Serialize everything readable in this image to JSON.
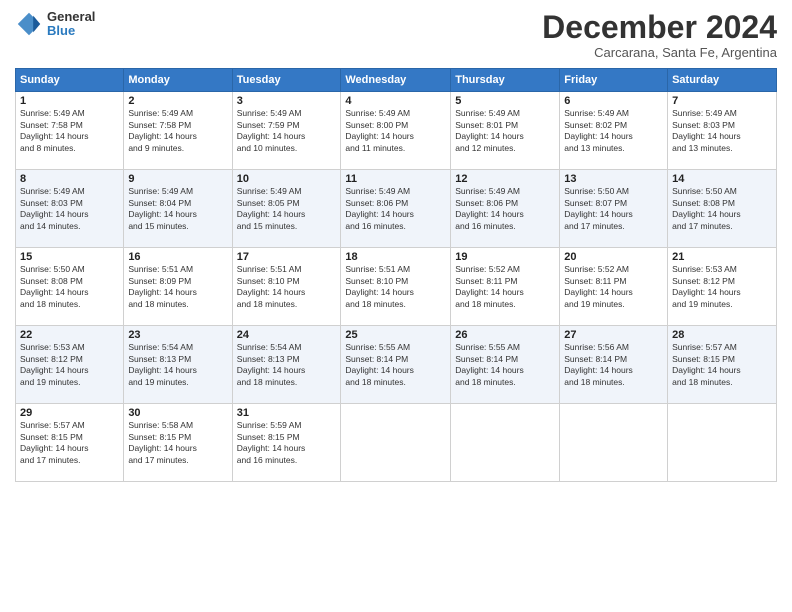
{
  "header": {
    "logo": {
      "general": "General",
      "blue": "Blue"
    },
    "title": "December 2024",
    "subtitle": "Carcarana, Santa Fe, Argentina"
  },
  "calendar": {
    "days_of_week": [
      "Sunday",
      "Monday",
      "Tuesday",
      "Wednesday",
      "Thursday",
      "Friday",
      "Saturday"
    ],
    "weeks": [
      [
        {
          "day": "1",
          "sunrise": "5:49 AM",
          "sunset": "7:58 PM",
          "daylight": "14 hours and 8 minutes."
        },
        {
          "day": "2",
          "sunrise": "5:49 AM",
          "sunset": "7:58 PM",
          "daylight": "14 hours and 9 minutes."
        },
        {
          "day": "3",
          "sunrise": "5:49 AM",
          "sunset": "7:59 PM",
          "daylight": "14 hours and 10 minutes."
        },
        {
          "day": "4",
          "sunrise": "5:49 AM",
          "sunset": "8:00 PM",
          "daylight": "14 hours and 11 minutes."
        },
        {
          "day": "5",
          "sunrise": "5:49 AM",
          "sunset": "8:01 PM",
          "daylight": "14 hours and 12 minutes."
        },
        {
          "day": "6",
          "sunrise": "5:49 AM",
          "sunset": "8:02 PM",
          "daylight": "14 hours and 13 minutes."
        },
        {
          "day": "7",
          "sunrise": "5:49 AM",
          "sunset": "8:03 PM",
          "daylight": "14 hours and 13 minutes."
        }
      ],
      [
        {
          "day": "8",
          "sunrise": "5:49 AM",
          "sunset": "8:03 PM",
          "daylight": "14 hours and 14 minutes."
        },
        {
          "day": "9",
          "sunrise": "5:49 AM",
          "sunset": "8:04 PM",
          "daylight": "14 hours and 15 minutes."
        },
        {
          "day": "10",
          "sunrise": "5:49 AM",
          "sunset": "8:05 PM",
          "daylight": "14 hours and 15 minutes."
        },
        {
          "day": "11",
          "sunrise": "5:49 AM",
          "sunset": "8:06 PM",
          "daylight": "14 hours and 16 minutes."
        },
        {
          "day": "12",
          "sunrise": "5:49 AM",
          "sunset": "8:06 PM",
          "daylight": "14 hours and 16 minutes."
        },
        {
          "day": "13",
          "sunrise": "5:50 AM",
          "sunset": "8:07 PM",
          "daylight": "14 hours and 17 minutes."
        },
        {
          "day": "14",
          "sunrise": "5:50 AM",
          "sunset": "8:08 PM",
          "daylight": "14 hours and 17 minutes."
        }
      ],
      [
        {
          "day": "15",
          "sunrise": "5:50 AM",
          "sunset": "8:08 PM",
          "daylight": "14 hours and 18 minutes."
        },
        {
          "day": "16",
          "sunrise": "5:51 AM",
          "sunset": "8:09 PM",
          "daylight": "14 hours and 18 minutes."
        },
        {
          "day": "17",
          "sunrise": "5:51 AM",
          "sunset": "8:10 PM",
          "daylight": "14 hours and 18 minutes."
        },
        {
          "day": "18",
          "sunrise": "5:51 AM",
          "sunset": "8:10 PM",
          "daylight": "14 hours and 18 minutes."
        },
        {
          "day": "19",
          "sunrise": "5:52 AM",
          "sunset": "8:11 PM",
          "daylight": "14 hours and 18 minutes."
        },
        {
          "day": "20",
          "sunrise": "5:52 AM",
          "sunset": "8:11 PM",
          "daylight": "14 hours and 19 minutes."
        },
        {
          "day": "21",
          "sunrise": "5:53 AM",
          "sunset": "8:12 PM",
          "daylight": "14 hours and 19 minutes."
        }
      ],
      [
        {
          "day": "22",
          "sunrise": "5:53 AM",
          "sunset": "8:12 PM",
          "daylight": "14 hours and 19 minutes."
        },
        {
          "day": "23",
          "sunrise": "5:54 AM",
          "sunset": "8:13 PM",
          "daylight": "14 hours and 19 minutes."
        },
        {
          "day": "24",
          "sunrise": "5:54 AM",
          "sunset": "8:13 PM",
          "daylight": "14 hours and 18 minutes."
        },
        {
          "day": "25",
          "sunrise": "5:55 AM",
          "sunset": "8:14 PM",
          "daylight": "14 hours and 18 minutes."
        },
        {
          "day": "26",
          "sunrise": "5:55 AM",
          "sunset": "8:14 PM",
          "daylight": "14 hours and 18 minutes."
        },
        {
          "day": "27",
          "sunrise": "5:56 AM",
          "sunset": "8:14 PM",
          "daylight": "14 hours and 18 minutes."
        },
        {
          "day": "28",
          "sunrise": "5:57 AM",
          "sunset": "8:15 PM",
          "daylight": "14 hours and 18 minutes."
        }
      ],
      [
        {
          "day": "29",
          "sunrise": "5:57 AM",
          "sunset": "8:15 PM",
          "daylight": "14 hours and 17 minutes."
        },
        {
          "day": "30",
          "sunrise": "5:58 AM",
          "sunset": "8:15 PM",
          "daylight": "14 hours and 17 minutes."
        },
        {
          "day": "31",
          "sunrise": "5:59 AM",
          "sunset": "8:15 PM",
          "daylight": "14 hours and 16 minutes."
        },
        null,
        null,
        null,
        null
      ]
    ]
  }
}
